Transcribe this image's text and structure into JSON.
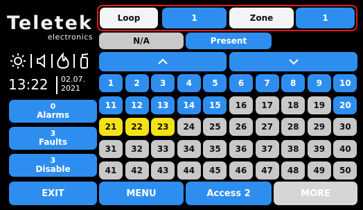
{
  "brand": {
    "name": "Teletek",
    "tagline": "electronics"
  },
  "status_icons": [
    "sun-icon",
    "volume-icon",
    "flame-icon",
    "extinguisher-icon"
  ],
  "clock": {
    "time": "13:22",
    "date_line1": "02.07.",
    "date_line2": "2021"
  },
  "header": {
    "loop_label": "Loop",
    "loop_value": "1",
    "zone_label": "Zone",
    "zone_value": "1"
  },
  "filters": {
    "na_label": "N/A",
    "present_label": "Present"
  },
  "nav": {
    "up_arrow": "^",
    "down_arrow": "⌄"
  },
  "side": {
    "alarms_count": "0",
    "alarms_label": "Alarms",
    "faults_count": "3",
    "faults_label": "Faults",
    "disable_count": "3",
    "disable_label": "Disable"
  },
  "grid": {
    "rows": [
      [
        {
          "n": "1",
          "s": "blue"
        },
        {
          "n": "2",
          "s": "blue"
        },
        {
          "n": "3",
          "s": "blue"
        },
        {
          "n": "4",
          "s": "blue"
        },
        {
          "n": "5",
          "s": "blue"
        },
        {
          "n": "6",
          "s": "blue"
        },
        {
          "n": "7",
          "s": "blue"
        },
        {
          "n": "8",
          "s": "blue"
        },
        {
          "n": "9",
          "s": "blue"
        },
        {
          "n": "10",
          "s": "blue"
        }
      ],
      [
        {
          "n": "11",
          "s": "blue"
        },
        {
          "n": "12",
          "s": "blue"
        },
        {
          "n": "13",
          "s": "blue"
        },
        {
          "n": "14",
          "s": "blue"
        },
        {
          "n": "15",
          "s": "blue"
        },
        {
          "n": "16",
          "s": "grey"
        },
        {
          "n": "17",
          "s": "grey"
        },
        {
          "n": "18",
          "s": "grey"
        },
        {
          "n": "19",
          "s": "grey"
        },
        {
          "n": "20",
          "s": "blue"
        }
      ],
      [
        {
          "n": "21",
          "s": "yellow"
        },
        {
          "n": "22",
          "s": "yellow"
        },
        {
          "n": "23",
          "s": "yellow"
        },
        {
          "n": "24",
          "s": "grey"
        },
        {
          "n": "25",
          "s": "grey"
        },
        {
          "n": "26",
          "s": "grey"
        },
        {
          "n": "27",
          "s": "grey"
        },
        {
          "n": "28",
          "s": "grey"
        },
        {
          "n": "29",
          "s": "grey"
        },
        {
          "n": "30",
          "s": "grey"
        }
      ],
      [
        {
          "n": "31",
          "s": "grey"
        },
        {
          "n": "32",
          "s": "grey"
        },
        {
          "n": "33",
          "s": "grey"
        },
        {
          "n": "34",
          "s": "grey"
        },
        {
          "n": "35",
          "s": "grey"
        },
        {
          "n": "36",
          "s": "grey"
        },
        {
          "n": "37",
          "s": "grey"
        },
        {
          "n": "38",
          "s": "grey"
        },
        {
          "n": "39",
          "s": "grey"
        },
        {
          "n": "40",
          "s": "grey"
        }
      ],
      [
        {
          "n": "41",
          "s": "grey"
        },
        {
          "n": "42",
          "s": "grey"
        },
        {
          "n": "43",
          "s": "grey"
        },
        {
          "n": "44",
          "s": "grey"
        },
        {
          "n": "45",
          "s": "grey"
        },
        {
          "n": "46",
          "s": "grey"
        },
        {
          "n": "47",
          "s": "grey"
        },
        {
          "n": "48",
          "s": "grey"
        },
        {
          "n": "49",
          "s": "grey"
        },
        {
          "n": "50",
          "s": "grey"
        }
      ]
    ]
  },
  "bottom": {
    "exit_label": "EXIT",
    "menu_label": "MENU",
    "access_label": "Access 2",
    "more_label": "MORE"
  },
  "colors": {
    "accent_blue": "#2e8ef0",
    "highlight_yellow": "#f4e216",
    "frame_red": "#e8191f",
    "inactive_grey": "#c9c9c9"
  }
}
